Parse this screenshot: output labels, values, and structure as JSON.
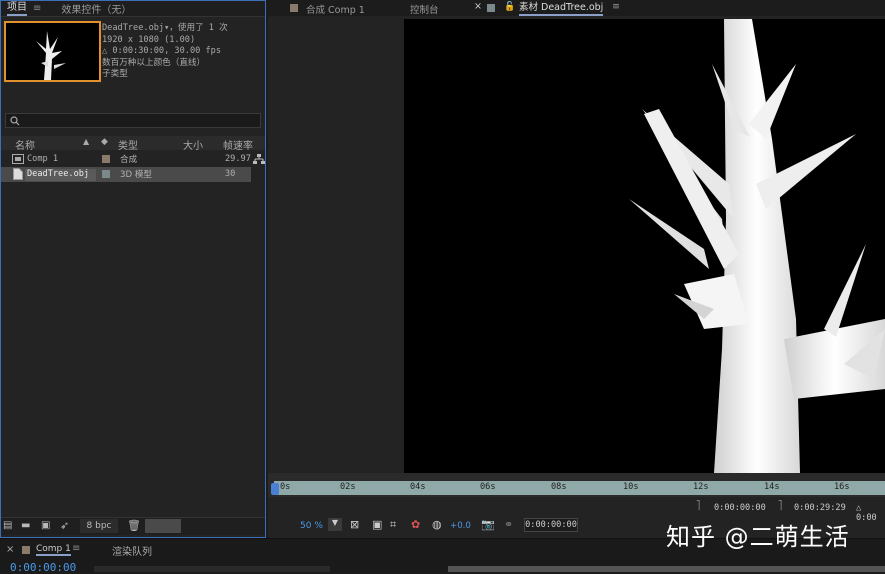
{
  "project_panel": {
    "tab_project": "项目",
    "tab_effects": "效果控件（无）",
    "menu_glyph": "≡",
    "info": {
      "line1": "DeadTree.obj▾，使用了 1 次",
      "line2": "1920 x 1080 (1.00)",
      "line3": "△ 0:00:30:00, 30.00 fps",
      "line4": "数百万种以上颜色（直线）",
      "line5": "子类型"
    },
    "search_icon": "search-icon",
    "columns": {
      "name": "名称",
      "type": "类型",
      "size": "大小",
      "fps": "帧速率"
    },
    "items": [
      {
        "name": "Comp 1",
        "type": "合成",
        "fps": "29.97",
        "color": "#8a7a6a"
      },
      {
        "name": "DeadTree.obj",
        "type": "3D 模型",
        "fps": "30",
        "color": "#7a8a8a"
      }
    ],
    "footer": {
      "bpc": "8 bpc"
    }
  },
  "viewer": {
    "tab_comp": "合成 Comp 1",
    "tab_console": "控制台",
    "tab_footage": "素材 DeadTree.obj",
    "ruler_ticks": [
      "0s",
      "02s",
      "04s",
      "06s",
      "08s",
      "10s",
      "12s",
      "14s",
      "16s"
    ],
    "timecode_in": "0:00:00:00",
    "timecode_out": "0:00:29:29",
    "duration": "△ 0:00",
    "zoom": "50 %",
    "exposure": "+0.0",
    "current_time": "0:00:00:00"
  },
  "bottom": {
    "tab_comp": "Comp 1",
    "tab_render": "渲染队列",
    "timecode": "0:00:00:00"
  },
  "watermark": "知乎 @二萌生活"
}
